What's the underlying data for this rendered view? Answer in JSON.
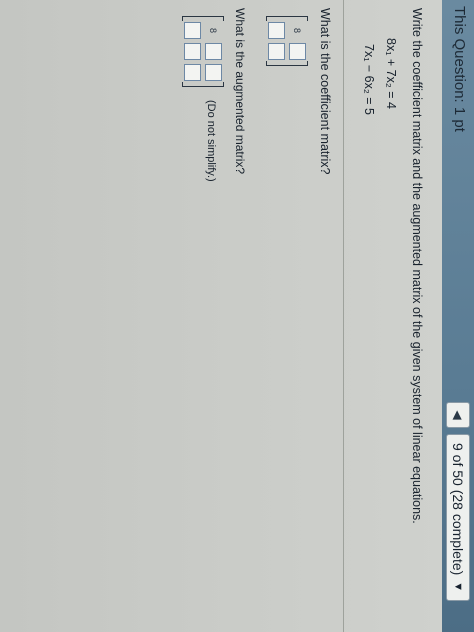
{
  "header": {
    "question_label": "This Question: 1 pt",
    "progress_text": "9 of 50 (28 complete)",
    "prev_icon": "triangle-left-icon",
    "dropdown_icon": "caret-down-icon"
  },
  "problem": {
    "prompt": "Write the coefficient matrix and the augmented matrix of the given system of linear equations.",
    "equations": [
      "8x₁ + 7x₂ = 4",
      "7x₁ − 6x₂ = 5"
    ]
  },
  "coefficient_matrix": {
    "question": "What is the coefficient matrix?",
    "cells": [
      "8",
      "",
      "",
      ""
    ]
  },
  "augmented_matrix": {
    "question": "What is the augmented matrix?",
    "cells": [
      "8",
      "",
      "",
      "",
      "",
      ""
    ],
    "hint": "(Do not simplify.)"
  },
  "colors": {
    "header_bar": "#5a7c94",
    "page_bg": "#c4c6c2",
    "answer_box_border": "#6d88a5"
  }
}
